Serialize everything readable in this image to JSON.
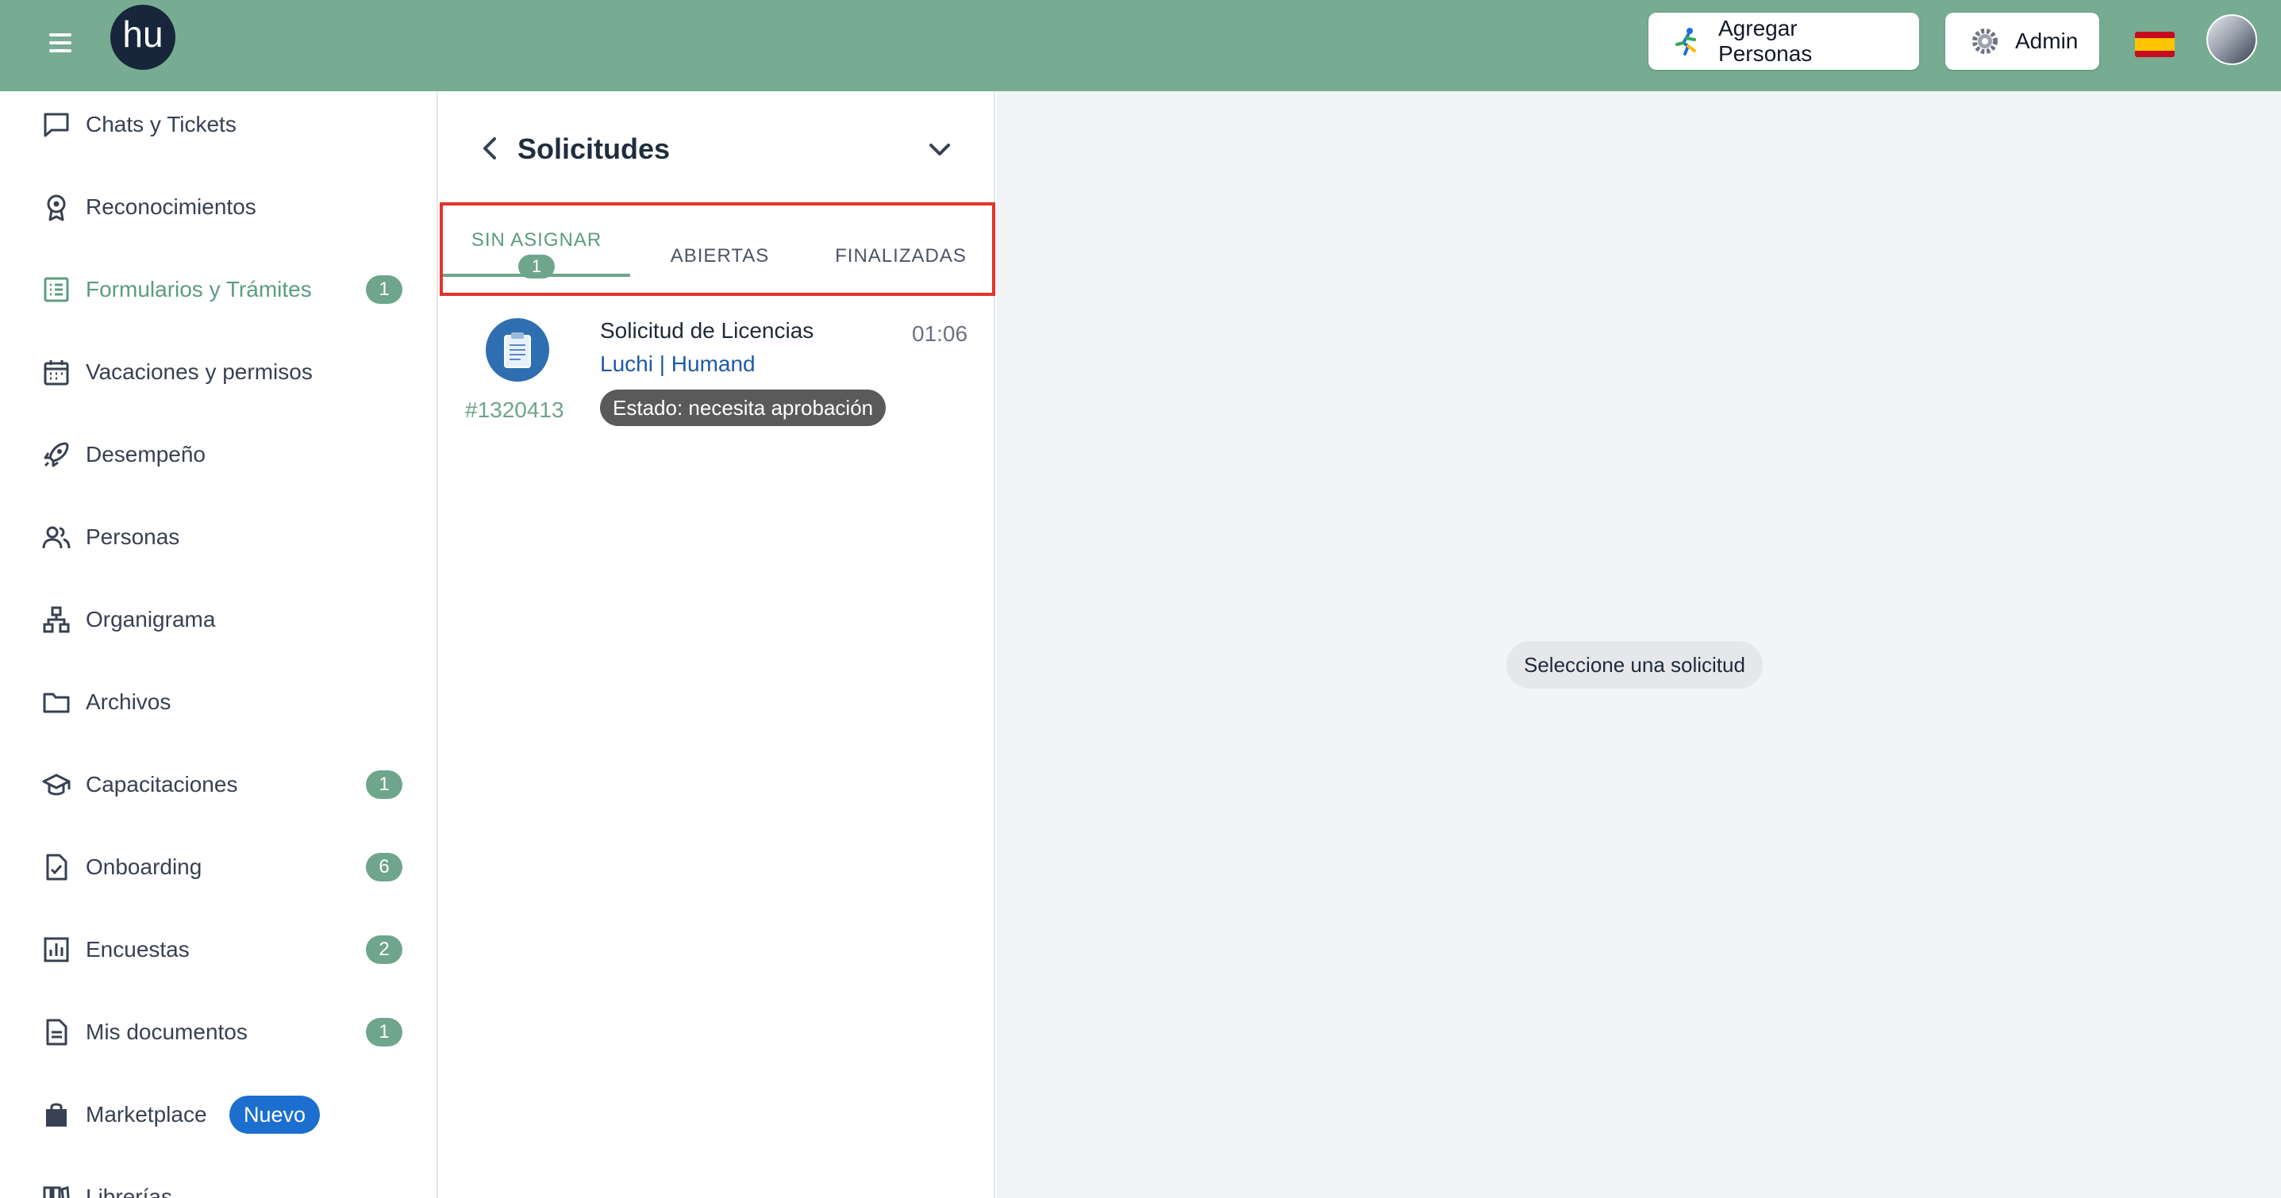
{
  "topbar": {
    "logo_text": "hu",
    "add_people_label": "Agregar Personas",
    "admin_label": "Admin",
    "language": "es"
  },
  "sidebar": {
    "items": [
      {
        "label": "Chats y Tickets",
        "icon": "chat-icon"
      },
      {
        "label": "Reconocimientos",
        "icon": "award-icon"
      },
      {
        "label": "Formularios y Trámites",
        "icon": "form-list-icon",
        "active": true,
        "badge": "1"
      },
      {
        "label": "Vacaciones y permisos",
        "icon": "calendar-icon"
      },
      {
        "label": "Desempeño",
        "icon": "rocket-icon"
      },
      {
        "label": "Personas",
        "icon": "people-icon"
      },
      {
        "label": "Organigrama",
        "icon": "org-chart-icon"
      },
      {
        "label": "Archivos",
        "icon": "folder-icon"
      },
      {
        "label": "Capacitaciones",
        "icon": "graduation-cap-icon",
        "badge": "1"
      },
      {
        "label": "Onboarding",
        "icon": "document-check-icon",
        "badge": "6"
      },
      {
        "label": "Encuestas",
        "icon": "bar-chart-icon",
        "badge": "2"
      },
      {
        "label": "Mis documentos",
        "icon": "document-icon",
        "badge": "1"
      },
      {
        "label": "Marketplace",
        "icon": "shopping-bag-icon",
        "tag": "Nuevo"
      },
      {
        "label": "Librerías",
        "icon": "library-icon"
      }
    ]
  },
  "requests_panel": {
    "title": "Solicitudes",
    "tabs": [
      {
        "label": "SIN ASIGNAR",
        "count": "1",
        "active": true
      },
      {
        "label": "ABIERTAS"
      },
      {
        "label": "FINALIZADAS"
      }
    ],
    "items": [
      {
        "id": "#1320413",
        "title": "Solicitud de Licencias",
        "subtitle": "Luchi | Humand",
        "time": "01:06",
        "status": "Estado: necesita aprobación"
      }
    ]
  },
  "detail": {
    "empty_message": "Seleccione una solicitud"
  },
  "colors": {
    "topbar": "#77ab92",
    "accent": "#6ea58b",
    "highlight_box": "#e4332b",
    "new_tag": "#1c6fcf"
  }
}
